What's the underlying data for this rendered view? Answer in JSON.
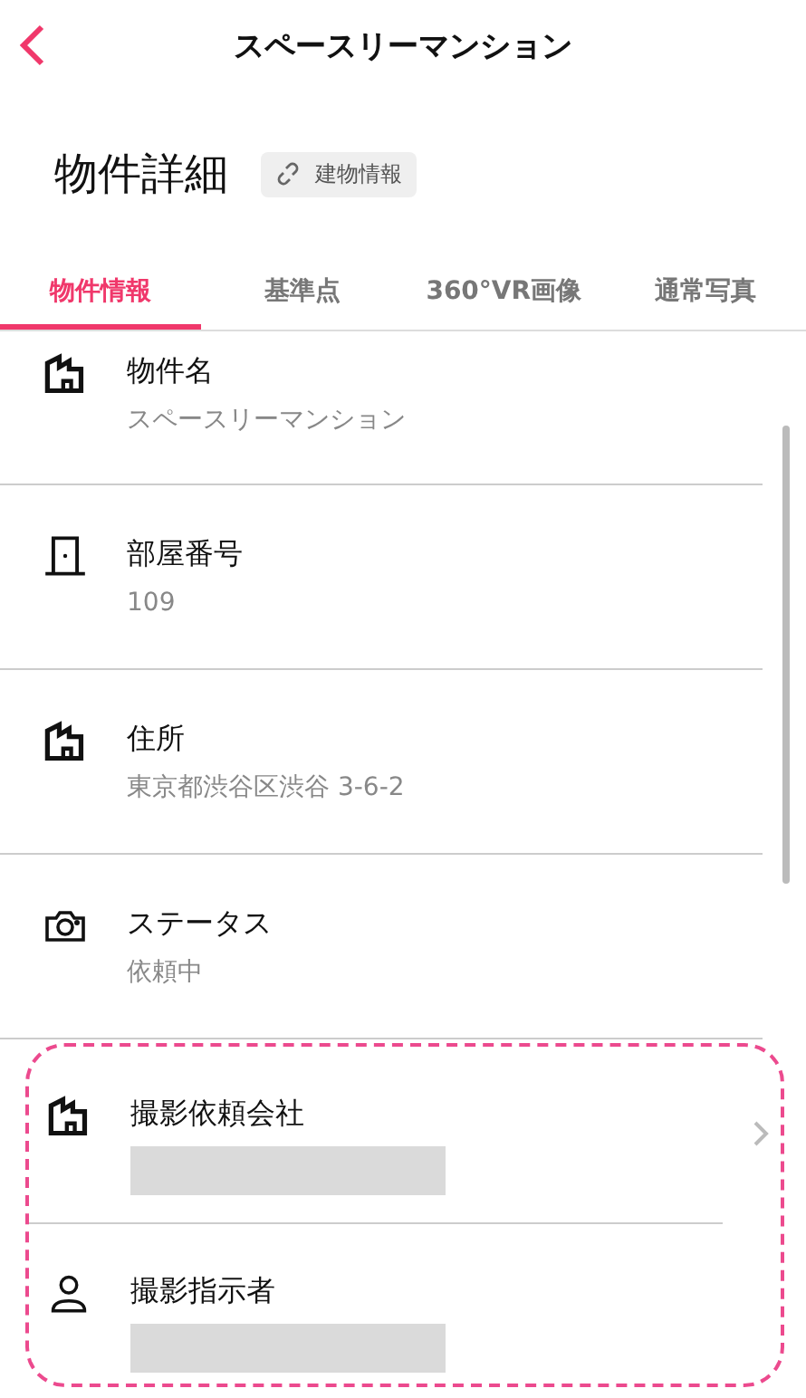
{
  "header": {
    "title": "スペースリーマンション"
  },
  "page_title": "物件詳細",
  "link_chip": {
    "label": "建物情報"
  },
  "tabs": [
    {
      "label": "物件情報",
      "selected": true
    },
    {
      "label": "基準点",
      "selected": false
    },
    {
      "label": "360°VR画像",
      "selected": false
    },
    {
      "label": "通常写真",
      "selected": false
    }
  ],
  "rows": [
    {
      "kind": "building",
      "label": "物件名",
      "value": "スペースリーマンション"
    },
    {
      "kind": "door",
      "label": "部屋番号",
      "value": "109"
    },
    {
      "kind": "building",
      "label": "住所",
      "value": "東京都渋谷区渋谷 3-6-2"
    },
    {
      "kind": "camera",
      "label": "ステータス",
      "value": "依頼中"
    }
  ],
  "highlighted_rows": [
    {
      "kind": "building",
      "label": "撮影依頼会社",
      "redacted": true,
      "chevron": true
    },
    {
      "kind": "person",
      "label": "撮影指示者",
      "redacted": true,
      "chevron": false
    }
  ]
}
